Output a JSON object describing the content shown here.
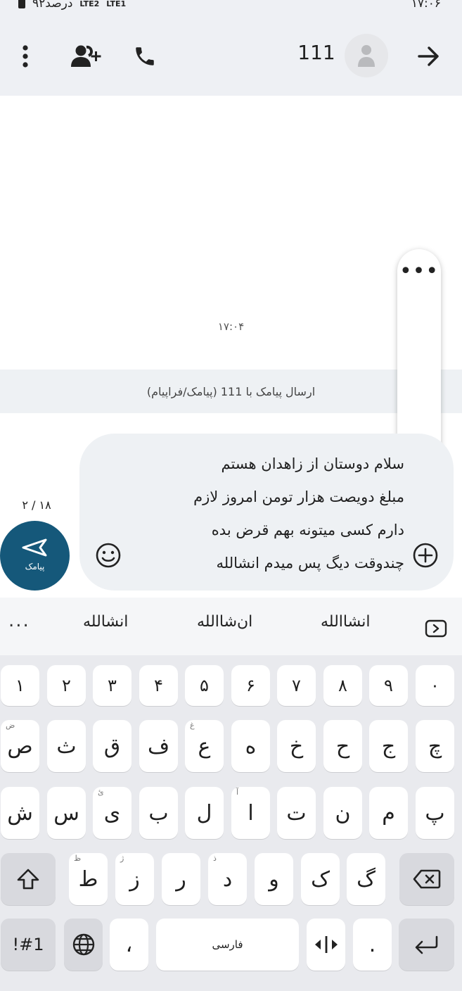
{
  "status_bar": {
    "battery_text": "۹۲درصد",
    "network_1": "LTE2",
    "network_2": "LTE1",
    "time": "۱۷:۰۶"
  },
  "header": {
    "contact_name": "111",
    "icons": [
      "back-arrow-icon",
      "avatar-person-icon",
      "phone-icon",
      "add-contact-icon",
      "more-vertical-icon"
    ]
  },
  "conversation": {
    "timestamp": "۱۷:۰۴",
    "send_info": "ارسال پیامک با 111 (پیامک/فراپیام)"
  },
  "compose": {
    "counter": "۲ / ۱۸",
    "send_label": "پیامک",
    "message_lines": [
      "سلام دوستان از زاهدان  هستم",
      "مبلغ دویصت هزار تومن امروز لازم",
      "دارم کسی میتونه بهم قرض بده",
      "چندوقت دیگ پس میدم انشالله"
    ]
  },
  "suggestions": {
    "items": [
      "انشاالله",
      "ان‌شاالله",
      "انشالله"
    ],
    "more": "..."
  },
  "keyboard": {
    "number_row": [
      "۰",
      "۹",
      "۸",
      "۷",
      "۶",
      "۵",
      "۴",
      "۳",
      "۲",
      "۱"
    ],
    "row1": [
      {
        "key": "چ",
        "hint": ""
      },
      {
        "key": "ج",
        "hint": ""
      },
      {
        "key": "ح",
        "hint": ""
      },
      {
        "key": "خ",
        "hint": ""
      },
      {
        "key": "ه",
        "hint": ""
      },
      {
        "key": "ع",
        "hint": "غ"
      },
      {
        "key": "ف",
        "hint": ""
      },
      {
        "key": "ق",
        "hint": ""
      },
      {
        "key": "ث",
        "hint": ""
      },
      {
        "key": "ص",
        "hint": "ض"
      }
    ],
    "row2": [
      {
        "key": "پ",
        "hint": ""
      },
      {
        "key": "م",
        "hint": ""
      },
      {
        "key": "ن",
        "hint": ""
      },
      {
        "key": "ت",
        "hint": ""
      },
      {
        "key": "ا",
        "hint": "آ"
      },
      {
        "key": "ل",
        "hint": ""
      },
      {
        "key": "ب",
        "hint": ""
      },
      {
        "key": "ی",
        "hint": "ئ"
      },
      {
        "key": "س",
        "hint": ""
      },
      {
        "key": "ش",
        "hint": ""
      }
    ],
    "row3": [
      {
        "key": "گ",
        "hint": ""
      },
      {
        "key": "ک",
        "hint": ""
      },
      {
        "key": "و",
        "hint": ""
      },
      {
        "key": "د",
        "hint": "ذ"
      },
      {
        "key": "ر",
        "hint": ""
      },
      {
        "key": "ز",
        "hint": "ژ"
      },
      {
        "key": "ط",
        "hint": "ظ"
      }
    ],
    "symbols_label": "!#1",
    "comma": "،",
    "space_label": "فارسی",
    "period": "."
  }
}
